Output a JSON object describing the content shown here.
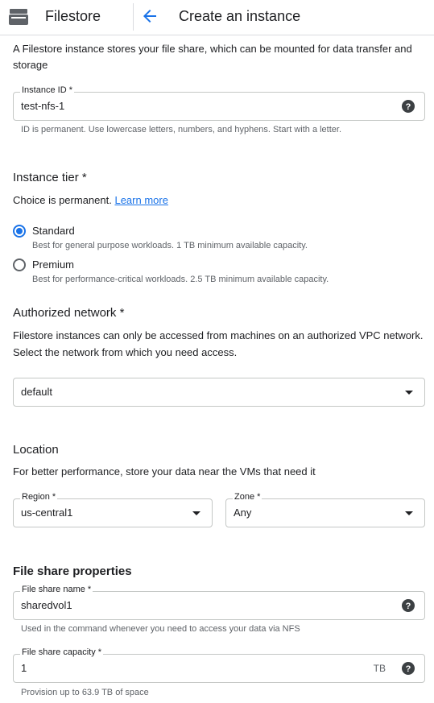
{
  "header": {
    "product_name": "Filestore",
    "page_title": "Create an instance"
  },
  "intro": {
    "line1": "A Filestore instance stores your file share, which can be mounted for data transfer and",
    "line2": "storage"
  },
  "instance_id": {
    "label": "Instance ID *",
    "value": "test-nfs-1",
    "hint": "ID is permanent. Use lowercase letters, numbers, and hyphens. Start with a letter."
  },
  "tier": {
    "title": "Instance tier *",
    "note_text": "Choice is permanent.",
    "learn_more": "Learn more",
    "options": [
      {
        "label": "Standard",
        "desc": "Best for general purpose workloads. 1 TB minimum available capacity.",
        "selected": true
      },
      {
        "label": "Premium",
        "desc": "Best for performance-critical workloads. 2.5 TB minimum available capacity.",
        "selected": false
      }
    ]
  },
  "network": {
    "title": "Authorized network *",
    "desc_line1": "Filestore instances can only be accessed from machines on an authorized VPC network.",
    "desc_line2": "Select the network from which you need access.",
    "value": "default"
  },
  "location": {
    "title": "Location",
    "desc": "For better performance, store your data near the VMs that need it",
    "region_label": "Region *",
    "region_value": "us-central1",
    "zone_label": "Zone *",
    "zone_value": "Any"
  },
  "file_share": {
    "title": "File share properties",
    "name_label": "File share name *",
    "name_value": "sharedvol1",
    "name_hint": "Used in the command whenever you need to access your data via NFS",
    "capacity_label": "File share capacity *",
    "capacity_value": "1",
    "capacity_unit": "TB",
    "capacity_hint": "Provision up to 63.9 TB of space"
  },
  "colors": {
    "accent": "#1a73e8",
    "text": "#202124",
    "secondary_text": "#5f6368",
    "border": "#c4c7c5"
  },
  "icons": {
    "product": "filestore-drive-icon",
    "back": "arrow-back-icon",
    "help": "help-circle-icon",
    "dropdown": "caret-down-icon"
  }
}
